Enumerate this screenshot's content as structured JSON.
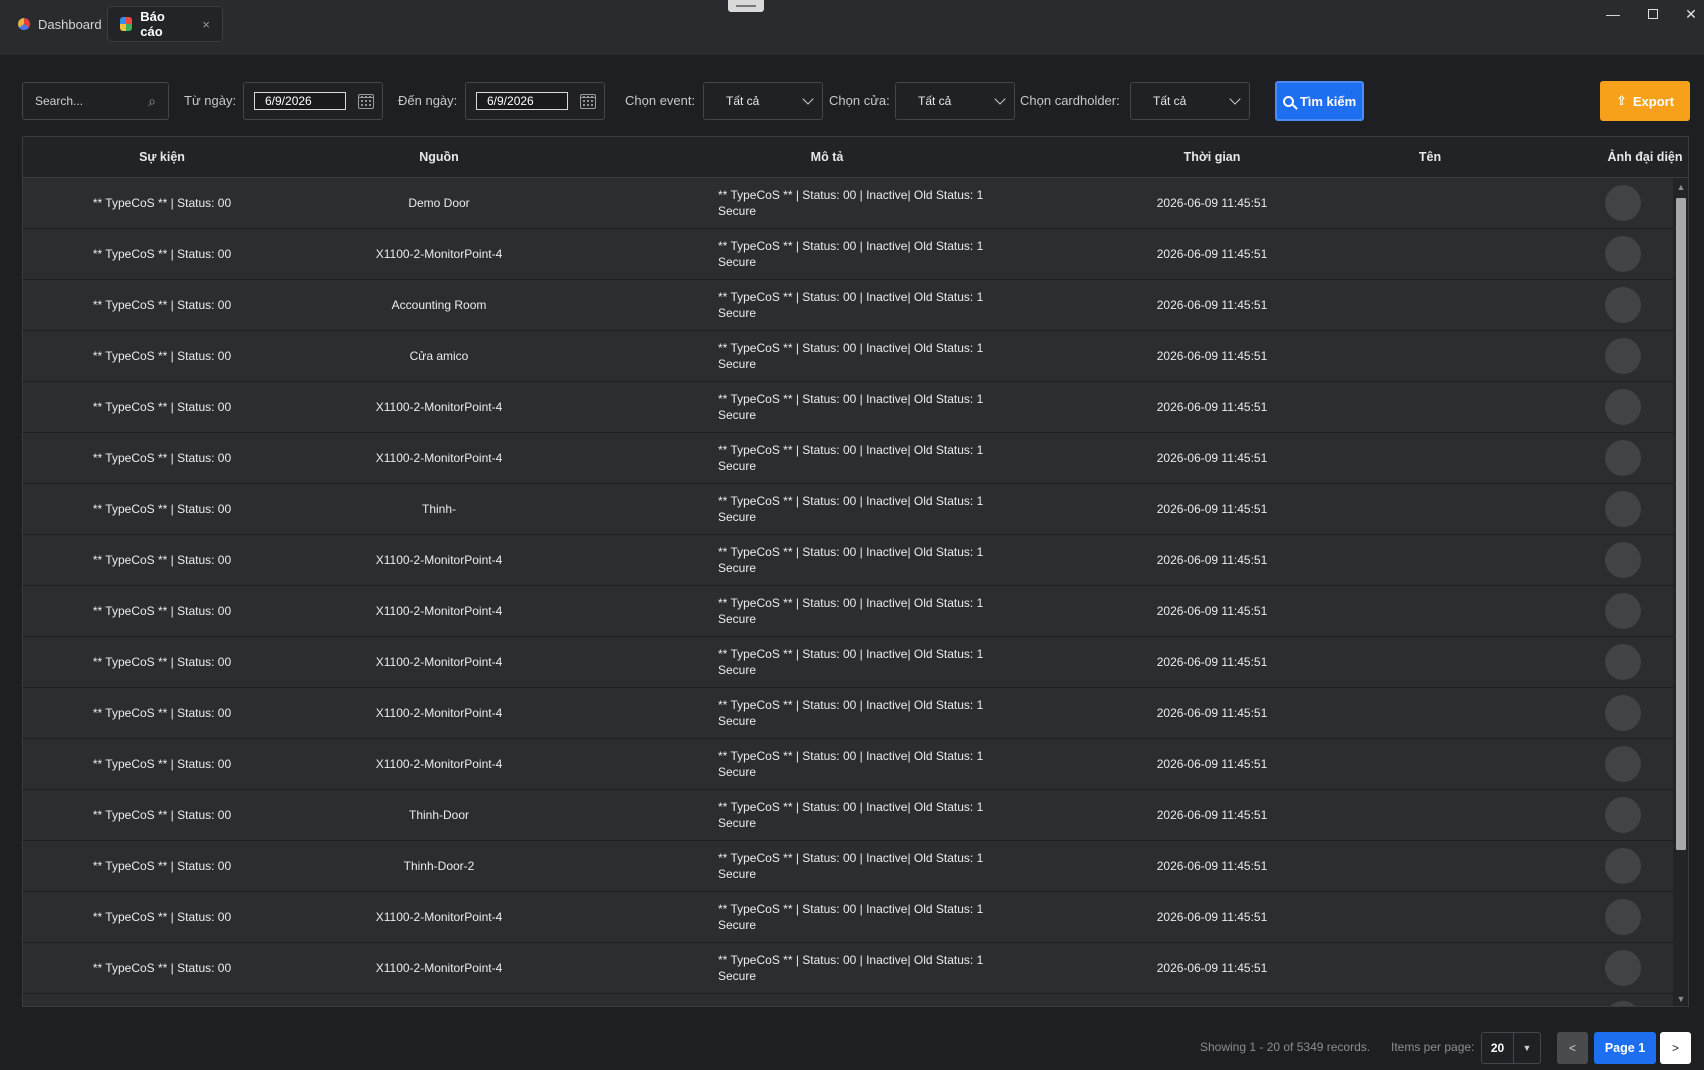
{
  "tabs": [
    {
      "label": "Dashboard"
    },
    {
      "label": "Báo cáo",
      "close": "×"
    }
  ],
  "window": {
    "minimize": "—",
    "close": "✕"
  },
  "toolbar": {
    "search_placeholder": "Search...",
    "from_label": "Từ ngày:",
    "from_value": "6/9/2026",
    "to_label": "Đến ngày:",
    "to_value": "6/9/2026",
    "event_label": "Chọn event:",
    "event_value": "Tất cả",
    "door_label": "Chọn cửa:",
    "door_value": "Tất cả",
    "cardholder_label": "Chọn cardholder:",
    "cardholder_value": "Tất cả",
    "search_button": "Tìm kiếm",
    "export_button": "Export"
  },
  "colors": {
    "accent": "#1e6ef2",
    "export": "#f7a11a"
  },
  "table": {
    "columns": [
      "Sự kiện",
      "Nguồn",
      "Mô tả",
      "Thời gian",
      "Tên",
      "Ảnh đại diện"
    ],
    "rows": [
      {
        "event": "** TypeCoS ** | Status: 00",
        "source": "Demo Door",
        "desc1": "** TypeCoS ** | Status: 00 |  Inactive| Old Status: 1",
        "desc2": "Secure",
        "time": "2026-06-09 11:45:51",
        "name": ""
      },
      {
        "event": "** TypeCoS ** | Status: 00",
        "source": "X1100-2-MonitorPoint-4",
        "desc1": "** TypeCoS ** | Status: 00 |  Inactive| Old Status: 1",
        "desc2": "Secure",
        "time": "2026-06-09 11:45:51",
        "name": ""
      },
      {
        "event": "** TypeCoS ** | Status: 00",
        "source": "Accounting Room",
        "desc1": "** TypeCoS ** | Status: 00 |  Inactive| Old Status: 1",
        "desc2": "Secure",
        "time": "2026-06-09 11:45:51",
        "name": ""
      },
      {
        "event": "** TypeCoS ** | Status: 00",
        "source": "Cửa amico",
        "desc1": "** TypeCoS ** | Status: 00 |  Inactive| Old Status: 1",
        "desc2": "Secure",
        "time": "2026-06-09 11:45:51",
        "name": ""
      },
      {
        "event": "** TypeCoS ** | Status: 00",
        "source": "X1100-2-MonitorPoint-4",
        "desc1": "** TypeCoS ** | Status: 00 |  Inactive| Old Status: 1",
        "desc2": "Secure",
        "time": "2026-06-09 11:45:51",
        "name": ""
      },
      {
        "event": "** TypeCoS ** | Status: 00",
        "source": "X1100-2-MonitorPoint-4",
        "desc1": "** TypeCoS ** | Status: 00 |  Inactive| Old Status: 1",
        "desc2": "Secure",
        "time": "2026-06-09 11:45:51",
        "name": ""
      },
      {
        "event": "** TypeCoS ** | Status: 00",
        "source": "Thinh-",
        "desc1": "** TypeCoS ** | Status: 00 |  Inactive| Old Status: 1",
        "desc2": "Secure",
        "time": "2026-06-09 11:45:51",
        "name": ""
      },
      {
        "event": "** TypeCoS ** | Status: 00",
        "source": "X1100-2-MonitorPoint-4",
        "desc1": "** TypeCoS ** | Status: 00 |  Inactive| Old Status: 1",
        "desc2": "Secure",
        "time": "2026-06-09 11:45:51",
        "name": ""
      },
      {
        "event": "** TypeCoS ** | Status: 00",
        "source": "X1100-2-MonitorPoint-4",
        "desc1": "** TypeCoS ** | Status: 00 |  Inactive| Old Status: 1",
        "desc2": "Secure",
        "time": "2026-06-09 11:45:51",
        "name": ""
      },
      {
        "event": "** TypeCoS ** | Status: 00",
        "source": "X1100-2-MonitorPoint-4",
        "desc1": "** TypeCoS ** | Status: 00 |  Inactive| Old Status: 1",
        "desc2": "Secure",
        "time": "2026-06-09 11:45:51",
        "name": ""
      },
      {
        "event": "** TypeCoS ** | Status: 00",
        "source": "X1100-2-MonitorPoint-4",
        "desc1": "** TypeCoS ** | Status: 00 |  Inactive| Old Status: 1",
        "desc2": "Secure",
        "time": "2026-06-09 11:45:51",
        "name": ""
      },
      {
        "event": "** TypeCoS ** | Status: 00",
        "source": "X1100-2-MonitorPoint-4",
        "desc1": "** TypeCoS ** | Status: 00 |  Inactive| Old Status: 1",
        "desc2": "Secure",
        "time": "2026-06-09 11:45:51",
        "name": ""
      },
      {
        "event": "** TypeCoS ** | Status: 00",
        "source": "Thinh-Door",
        "desc1": "** TypeCoS ** | Status: 00 |  Inactive| Old Status: 1",
        "desc2": "Secure",
        "time": "2026-06-09 11:45:51",
        "name": ""
      },
      {
        "event": "** TypeCoS ** | Status: 00",
        "source": "Thinh-Door-2",
        "desc1": "** TypeCoS ** | Status: 00 |  Inactive| Old Status: 1",
        "desc2": "Secure",
        "time": "2026-06-09 11:45:51",
        "name": ""
      },
      {
        "event": "** TypeCoS ** | Status: 00",
        "source": "X1100-2-MonitorPoint-4",
        "desc1": "** TypeCoS ** | Status: 00 |  Inactive| Old Status: 1",
        "desc2": "Secure",
        "time": "2026-06-09 11:45:51",
        "name": ""
      },
      {
        "event": "** TypeCoS ** | Status: 00",
        "source": "X1100-2-MonitorPoint-4",
        "desc1": "** TypeCoS ** | Status: 00 |  Inactive| Old Status: 1",
        "desc2": "Secure",
        "time": "2026-06-09 11:45:51",
        "name": ""
      }
    ]
  },
  "footer": {
    "showing": "Showing 1 - 20 of 5349 records.",
    "items_per_page_label": "Items per page:",
    "items_per_page_value": "20",
    "prev": "<",
    "current_page": "Page 1",
    "next": ">"
  }
}
